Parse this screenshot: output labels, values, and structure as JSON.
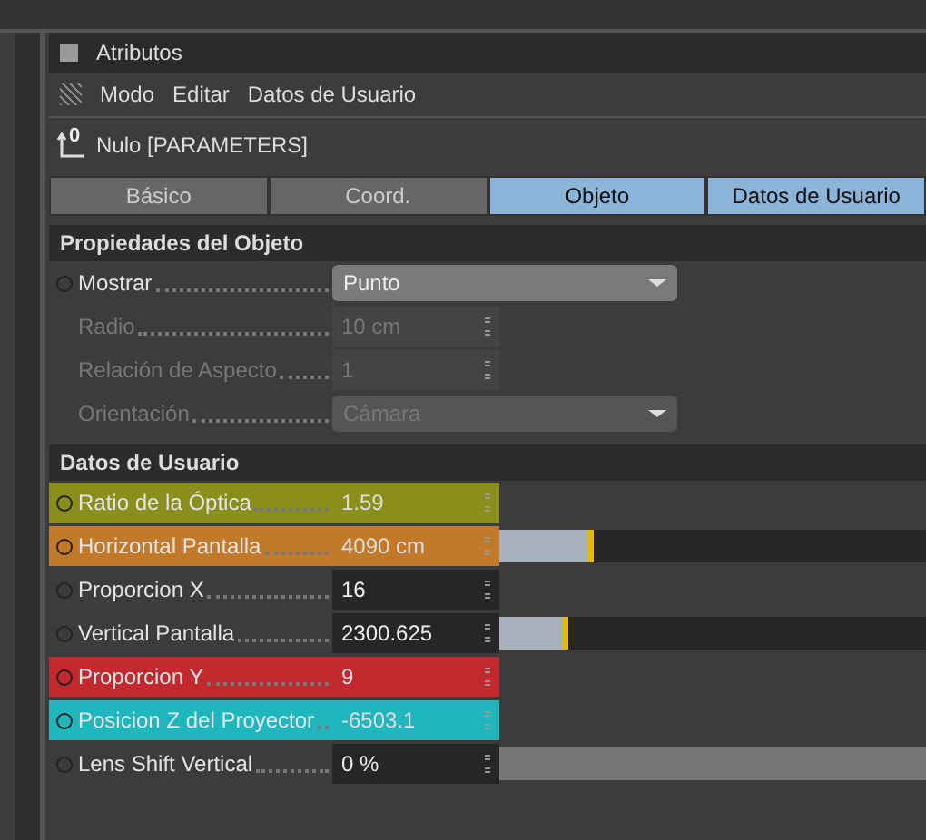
{
  "panel": {
    "title": "Atributos"
  },
  "menu": [
    "Modo",
    "Editar",
    "Datos de Usuario"
  ],
  "object": {
    "badge": "0",
    "name": "Nulo [PARAMETERS]"
  },
  "tabs": [
    {
      "label": "Básico",
      "selected": false
    },
    {
      "label": "Coord.",
      "selected": false
    },
    {
      "label": "Objeto",
      "selected": true
    },
    {
      "label": "Datos de Usuario",
      "selected": true
    }
  ],
  "sections": [
    {
      "title": "Propiedades del Objeto",
      "rows": [
        {
          "kind": "dropdown",
          "label": "Mostrar",
          "value": "Punto",
          "disabled": false
        },
        {
          "kind": "number",
          "label": "Radio",
          "value": "10 cm",
          "disabled": true
        },
        {
          "kind": "number",
          "label": "Relación de Aspecto",
          "value": "1",
          "disabled": true
        },
        {
          "kind": "dropdown",
          "label": "Orientación",
          "value": "Cámara",
          "disabled": true
        }
      ]
    },
    {
      "title": "Datos de Usuario",
      "rows": [
        {
          "kind": "number",
          "label": "Ratio de la Óptica",
          "value": "1.59",
          "disabled": false,
          "color": "#8a8f1c"
        },
        {
          "kind": "slider",
          "label": "Horizontal Pantalla",
          "value": "4090 cm",
          "disabled": false,
          "color": "#c27a2a",
          "level": 0.22
        },
        {
          "kind": "number",
          "label": "Proporcion X",
          "value": "16",
          "disabled": false
        },
        {
          "kind": "slider",
          "label": "Vertical Pantalla",
          "value": "2300.625",
          "disabled": false,
          "level": 0.16
        },
        {
          "kind": "number",
          "label": "Proporcion Y",
          "value": "9",
          "disabled": false,
          "color": "#c3282e"
        },
        {
          "kind": "number",
          "label": "Posicion Z del Proyector",
          "value": "-6503.1",
          "disabled": false,
          "color": "#1fb7bd"
        },
        {
          "kind": "slider",
          "label": "Lens Shift Vertical",
          "value": "0 %",
          "disabled": false,
          "level": 0
        }
      ]
    }
  ]
}
